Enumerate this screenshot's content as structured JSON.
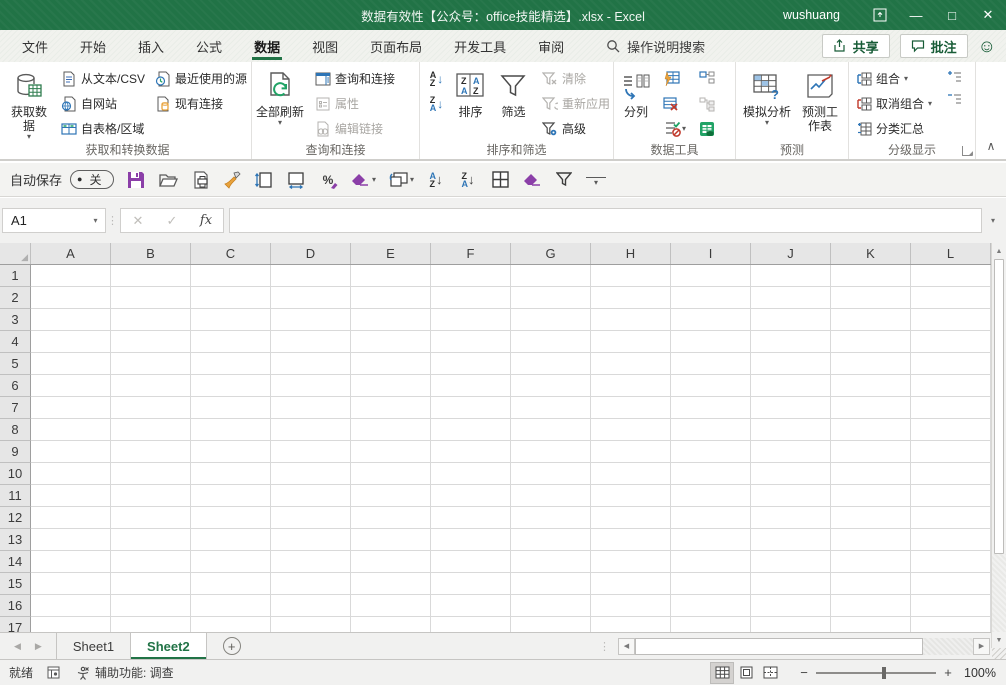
{
  "title_bar": {
    "title": "数据有效性【公众号：office技能精选】.xlsx  -  Excel",
    "user": "wushuang"
  },
  "glyphs": {
    "minimize": "—",
    "maximize": "□",
    "close": "✕",
    "smiley": "☺",
    "chevron_down": "▾",
    "collapse_ribbon": "∧",
    "dots": "⋮",
    "scroll_up": "▲",
    "scroll_down": "▼",
    "scroll_left": "◀",
    "scroll_right": "◀",
    "nav_left": "◀",
    "nav_right": "▶",
    "hs_right": "▶",
    "letter_a": "A",
    "letter_z": "Z",
    "arrow_down": "↓",
    "dot": "●",
    "plus": "+",
    "minus": "−",
    "percent": "%",
    "cancel": "✕",
    "enter": "✓"
  },
  "tabs": {
    "items": [
      {
        "label": "文件"
      },
      {
        "label": "开始"
      },
      {
        "label": "插入"
      },
      {
        "label": "公式"
      },
      {
        "label": "数据"
      },
      {
        "label": "视图"
      },
      {
        "label": "页面布局"
      },
      {
        "label": "开发工具"
      },
      {
        "label": "审阅"
      }
    ],
    "search_label": "操作说明搜索",
    "share_label": "共享",
    "comments_label": "批注"
  },
  "ribbon": {
    "group_labels": [
      "获取和转换数据",
      "查询和连接",
      "排序和筛选",
      "数据工具",
      "预测",
      "分级显示"
    ],
    "get_data": "获取数据",
    "from_text_csv": "从文本/CSV",
    "from_web": "自网站",
    "from_table": "自表格/区域",
    "recent_sources": "最近使用的源",
    "existing_connections": "现有连接",
    "refresh_all": "全部刷新",
    "queries_connections": "查询和连接",
    "properties": "属性",
    "edit_links": "编辑链接",
    "sort": "排序",
    "filter": "筛选",
    "clear": "清除",
    "reapply": "重新应用",
    "advanced": "高级",
    "text_to_columns": "分列",
    "what_if": "模拟分析",
    "forecast_sheet": "预测工作表",
    "group": "组合",
    "ungroup": "取消组合",
    "subtotal": "分类汇总"
  },
  "qat": {
    "autosave_label": "自动保存",
    "autosave_state": "关"
  },
  "formula_bar": {
    "name_box": "A1",
    "fx": "fx"
  },
  "grid": {
    "columns": [
      "A",
      "B",
      "C",
      "D",
      "E",
      "F",
      "G",
      "H",
      "I",
      "J",
      "K",
      "L"
    ],
    "row_count": 17
  },
  "sheets": {
    "items": [
      {
        "label": "Sheet1"
      },
      {
        "label": "Sheet2"
      }
    ]
  },
  "status_bar": {
    "ready": "就绪",
    "accessibility": "辅助功能: 调查",
    "zoom": "100%"
  },
  "colors": {
    "brand_green": "#217346",
    "accent_blue": "#3b6cb4",
    "icon_green": "#107c41",
    "qat_purple": "#8b3fa8",
    "painter_orange": "#e8a33d",
    "disabled_gray": "#a8a6a2"
  }
}
